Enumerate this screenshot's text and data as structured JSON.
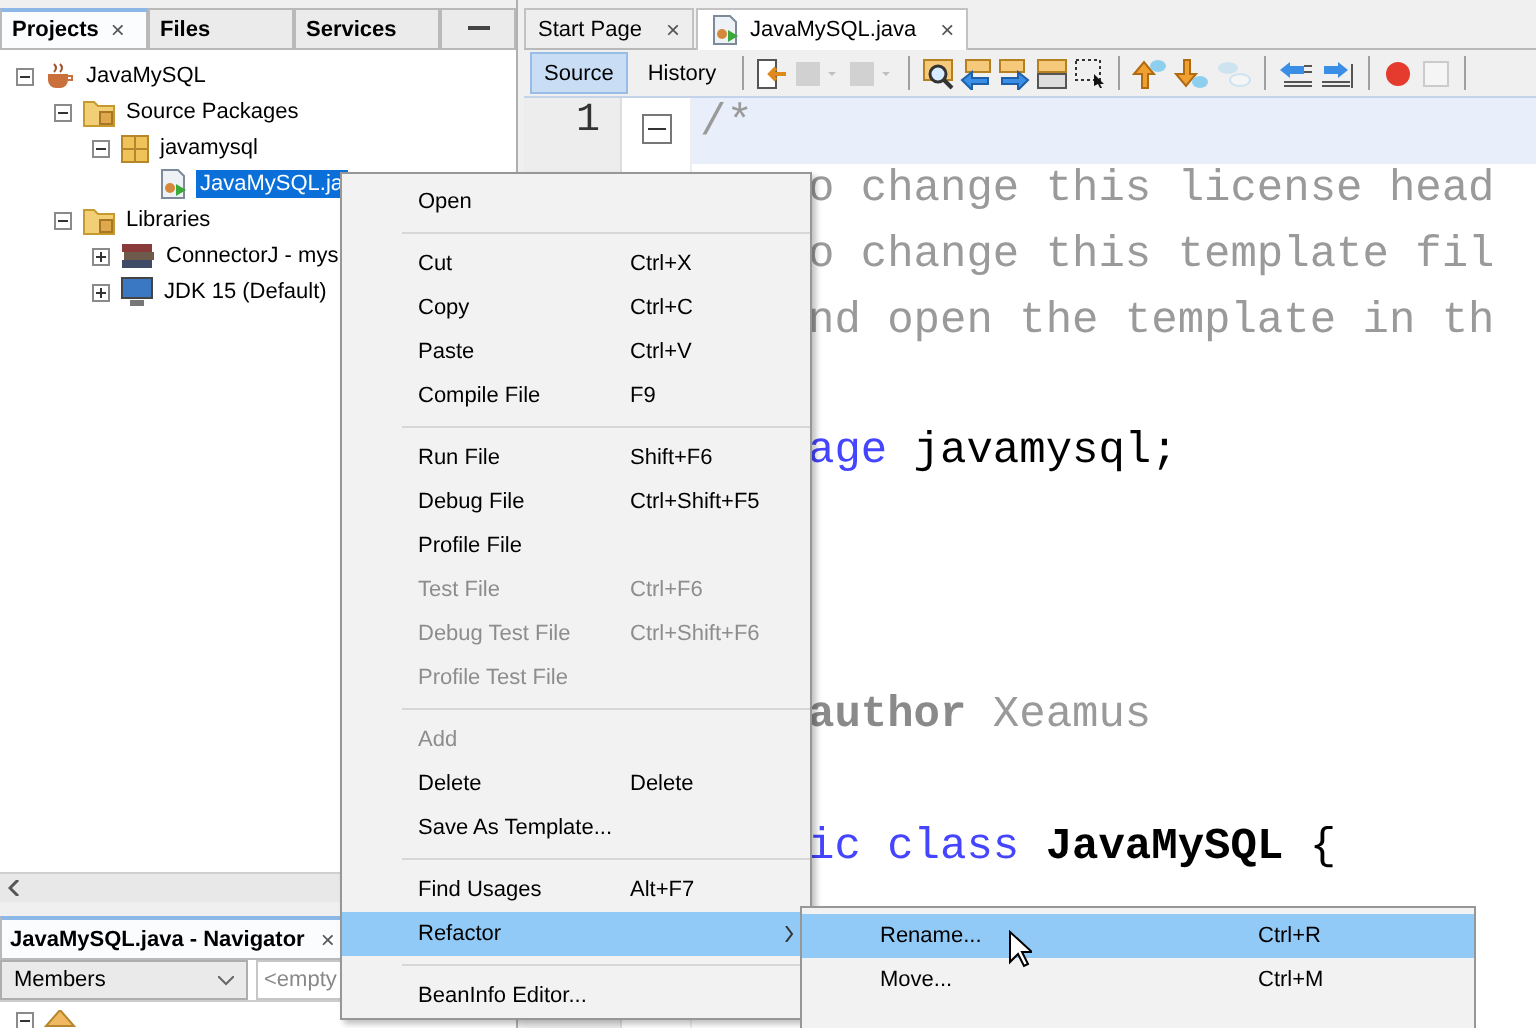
{
  "projects_panel": {
    "tabs": [
      {
        "label": "Projects",
        "selected": true,
        "close": "×"
      },
      {
        "label": "Files",
        "selected": false
      },
      {
        "label": "Services",
        "selected": false
      }
    ],
    "tree": [
      {
        "label": "JavaMySQL",
        "kind": "project",
        "expanded": true,
        "selected": false,
        "children": [
          {
            "label": "Source Packages",
            "kind": "folder",
            "expanded": true,
            "selected": false,
            "children": [
              {
                "label": "javamysql",
                "kind": "package",
                "expanded": true,
                "selected": false,
                "children": [
                  {
                    "label": "JavaMySQL.ja",
                    "kind": "java-file",
                    "selected": true
                  }
                ]
              }
            ]
          },
          {
            "label": "Libraries",
            "kind": "folder",
            "expanded": true,
            "selected": false,
            "children": [
              {
                "label": "ConnectorJ - mys",
                "kind": "library",
                "expanded": false,
                "selected": false
              },
              {
                "label": "JDK 15 (Default)",
                "kind": "jdk",
                "expanded": false,
                "selected": false
              }
            ]
          }
        ]
      }
    ]
  },
  "navigator": {
    "title": "JavaMySQL.java - Navigator",
    "close": "×",
    "filter": "Members",
    "filter_value": "<empty",
    "tree": [
      {
        "kind": "class",
        "expanded": true
      }
    ]
  },
  "editor": {
    "tabs": [
      {
        "label": "Start Page",
        "selected": false,
        "close": "×",
        "icon": false
      },
      {
        "label": "JavaMySQL.java",
        "selected": true,
        "close": "×",
        "icon": true
      }
    ],
    "views": [
      {
        "label": "Source",
        "selected": true
      },
      {
        "label": "History",
        "selected": false
      }
    ],
    "toolbar": [
      {
        "kind": "sep"
      },
      {
        "kind": "last-edit",
        "disabled": false
      },
      {
        "kind": "back",
        "disabled": true
      },
      {
        "kind": "forward",
        "disabled": true
      },
      {
        "kind": "sep"
      },
      {
        "kind": "find",
        "disabled": false
      },
      {
        "kind": "find-prev",
        "disabled": false
      },
      {
        "kind": "find-next",
        "disabled": false
      },
      {
        "kind": "highlight",
        "disabled": false
      },
      {
        "kind": "rect-select",
        "disabled": false
      },
      {
        "kind": "sep"
      },
      {
        "kind": "up",
        "disabled": false
      },
      {
        "kind": "down",
        "disabled": false
      },
      {
        "kind": "bookmark",
        "disabled": true
      },
      {
        "kind": "sep"
      },
      {
        "kind": "shift-left",
        "disabled": false
      },
      {
        "kind": "shift-right",
        "disabled": false
      },
      {
        "kind": "sep"
      },
      {
        "kind": "record",
        "disabled": false
      },
      {
        "kind": "stop",
        "disabled": true
      },
      {
        "kind": "sep"
      }
    ],
    "line_number": "1",
    "first_line": [
      {
        "text": "/*",
        "kind": "comment"
      }
    ],
    "lines": [
      {
        "kind": "code",
        "tokens": [
          {
            "text": "o change this license head",
            "kind": "comment"
          }
        ]
      },
      {
        "kind": "code",
        "tokens": [
          {
            "text": "o change this template fil",
            "kind": "comment"
          }
        ]
      },
      {
        "kind": "code",
        "tokens": [
          {
            "text": "nd open the template in th",
            "kind": "comment"
          }
        ]
      },
      {
        "kind": "blank"
      },
      {
        "kind": "code",
        "tokens": [
          {
            "text": "age",
            "kind": "keyword"
          },
          {
            "text": " javamysql;",
            "kind": "plain"
          }
        ]
      },
      {
        "kind": "blank"
      },
      {
        "kind": "blank"
      },
      {
        "kind": "blank"
      },
      {
        "kind": "code",
        "tokens": [
          {
            "text": "author",
            "kind": "tag"
          },
          {
            "text": " Xeamus",
            "kind": "comment"
          }
        ]
      },
      {
        "kind": "blank"
      },
      {
        "kind": "code",
        "tokens": [
          {
            "text": "ic class",
            "kind": "keyword"
          },
          {
            "text": " JavaMySQL",
            "kind": "name"
          },
          {
            "text": " {",
            "kind": "plain"
          }
        ]
      }
    ]
  },
  "context_menu": [
    {
      "kind": "item",
      "label": "Open",
      "disabled": false
    },
    {
      "kind": "sep"
    },
    {
      "kind": "item",
      "label": "Cut",
      "shortcut": "Ctrl+X",
      "disabled": false
    },
    {
      "kind": "item",
      "label": "Copy",
      "shortcut": "Ctrl+C",
      "disabled": false
    },
    {
      "kind": "item",
      "label": "Paste",
      "shortcut": "Ctrl+V",
      "disabled": false
    },
    {
      "kind": "item",
      "label": "Compile File",
      "shortcut": "F9",
      "disabled": false
    },
    {
      "kind": "sep"
    },
    {
      "kind": "item",
      "label": "Run File",
      "shortcut": "Shift+F6",
      "disabled": false
    },
    {
      "kind": "item",
      "label": "Debug File",
      "shortcut": "Ctrl+Shift+F5",
      "disabled": false
    },
    {
      "kind": "item",
      "label": "Profile File",
      "disabled": false
    },
    {
      "kind": "item",
      "label": "Test File",
      "shortcut": "Ctrl+F6",
      "disabled": true
    },
    {
      "kind": "item",
      "label": "Debug Test File",
      "shortcut": "Ctrl+Shift+F6",
      "disabled": true
    },
    {
      "kind": "item",
      "label": "Profile Test File",
      "disabled": true
    },
    {
      "kind": "sep"
    },
    {
      "kind": "item",
      "label": "Add",
      "disabled": true
    },
    {
      "kind": "item",
      "label": "Delete",
      "shortcut": "Delete",
      "disabled": false
    },
    {
      "kind": "item",
      "label": "Save As Template...",
      "disabled": false
    },
    {
      "kind": "sep"
    },
    {
      "kind": "item",
      "label": "Find Usages",
      "shortcut": "Alt+F7",
      "disabled": false
    },
    {
      "kind": "submenu",
      "label": "Refactor",
      "selected": true
    },
    {
      "kind": "sep"
    },
    {
      "kind": "item",
      "label": "BeanInfo Editor...",
      "disabled": false
    }
  ],
  "submenu": [
    {
      "label": "Rename...",
      "shortcut": "Ctrl+R",
      "selected": true
    },
    {
      "label": "Move...",
      "shortcut": "Ctrl+M",
      "selected": false
    }
  ]
}
